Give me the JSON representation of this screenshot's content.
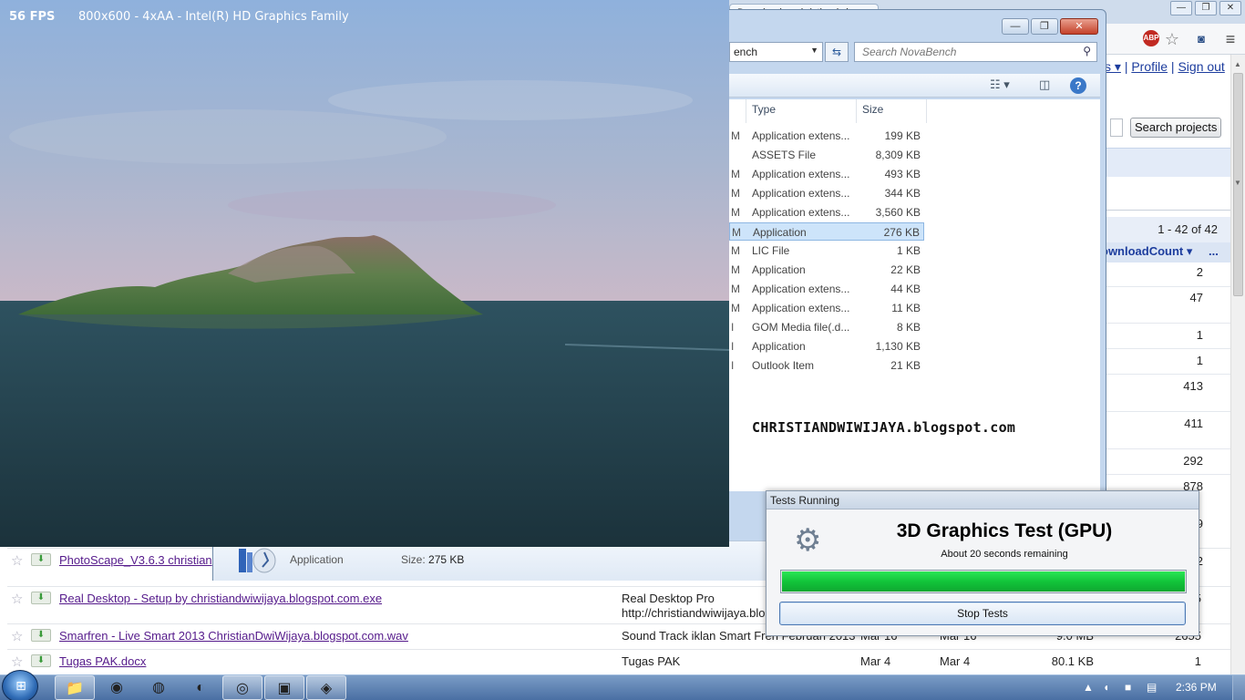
{
  "scene": {
    "fps": "56 FPS",
    "info": "800x600 - 4xAA - Intel(R) HD Graphics Family"
  },
  "browser": {
    "tab_title": "Downloads - christiandwi",
    "links": {
      "arrow": "s ▾",
      "profile": "Profile",
      "signout": "Sign out"
    },
    "search_button": "Search projects",
    "count": "1 - 42 of 42",
    "column_header": "ownloadCount ▾",
    "more": "...",
    "download_counts": [
      "2",
      "47",
      "1",
      "1",
      "413",
      "411",
      "292",
      "878",
      "9",
      "2"
    ],
    "files": [
      {
        "name": "PhotoScape_V3.6.3 christian",
        "summary": "",
        "summary2": "",
        "uploaded": "",
        "updated": "",
        "size": "",
        "count": "2"
      },
      {
        "name": "Real Desktop - Setup by christiandwiwijaya.blogspot.com.exe",
        "summary": "Real Desktop Pro",
        "summary2": "http://christiandwiwijaya.blo",
        "uploaded": "",
        "updated": "",
        "size": "",
        "count": "5"
      },
      {
        "name": "Smarfren - Live Smart 2013 ChristianDwiWijaya.blogspot.com.wav",
        "summary": "Sound Track iklan Smart Fren Februari 2013",
        "summary2": "",
        "uploaded": "Mar 16",
        "updated": "Mar 16",
        "size": "9.0 MB",
        "count": "2655"
      },
      {
        "name": "Tugas PAK.docx",
        "summary": "Tugas PAK",
        "summary2": "",
        "uploaded": "Mar 4",
        "updated": "Mar 4",
        "size": "80.1 KB",
        "count": "1"
      }
    ]
  },
  "explorer": {
    "address": "ench",
    "search_placeholder": "Search NovaBench",
    "columns": {
      "type": "Type",
      "size": "Size"
    },
    "rows": [
      {
        "mark": "M",
        "type": "Application extens...",
        "size": "199 KB"
      },
      {
        "mark": "",
        "type": "ASSETS File",
        "size": "8,309 KB"
      },
      {
        "mark": "M",
        "type": "Application extens...",
        "size": "493 KB"
      },
      {
        "mark": "M",
        "type": "Application extens...",
        "size": "344 KB"
      },
      {
        "mark": "M",
        "type": "Application extens...",
        "size": "3,560 KB"
      },
      {
        "mark": "M",
        "type": "Application",
        "size": "276 KB",
        "selected": true
      },
      {
        "mark": "M",
        "type": "LIC File",
        "size": "1 KB"
      },
      {
        "mark": "M",
        "type": "Application",
        "size": "22 KB"
      },
      {
        "mark": "M",
        "type": "Application extens...",
        "size": "44 KB"
      },
      {
        "mark": "M",
        "type": "Application extens...",
        "size": "11 KB"
      },
      {
        "mark": "I",
        "type": "GOM Media file(.d...",
        "size": "8 KB"
      },
      {
        "mark": "I",
        "type": "Application",
        "size": "1,130 KB"
      },
      {
        "mark": "I",
        "type": "Outlook Item",
        "size": "21 KB"
      }
    ],
    "watermark": "CHRISTIANDWIWIJAYA.blogspot.com",
    "details": {
      "type": "Application",
      "size_label": "Size:",
      "size_value": "275 KB"
    }
  },
  "tests": {
    "title": "Tests Running",
    "heading": "3D Graphics Test (GPU)",
    "remaining": "About 20 seconds remaining",
    "progress": 1.0,
    "stop_label": "Stop Tests"
  },
  "taskbar": {
    "clock": "2:36 PM"
  }
}
